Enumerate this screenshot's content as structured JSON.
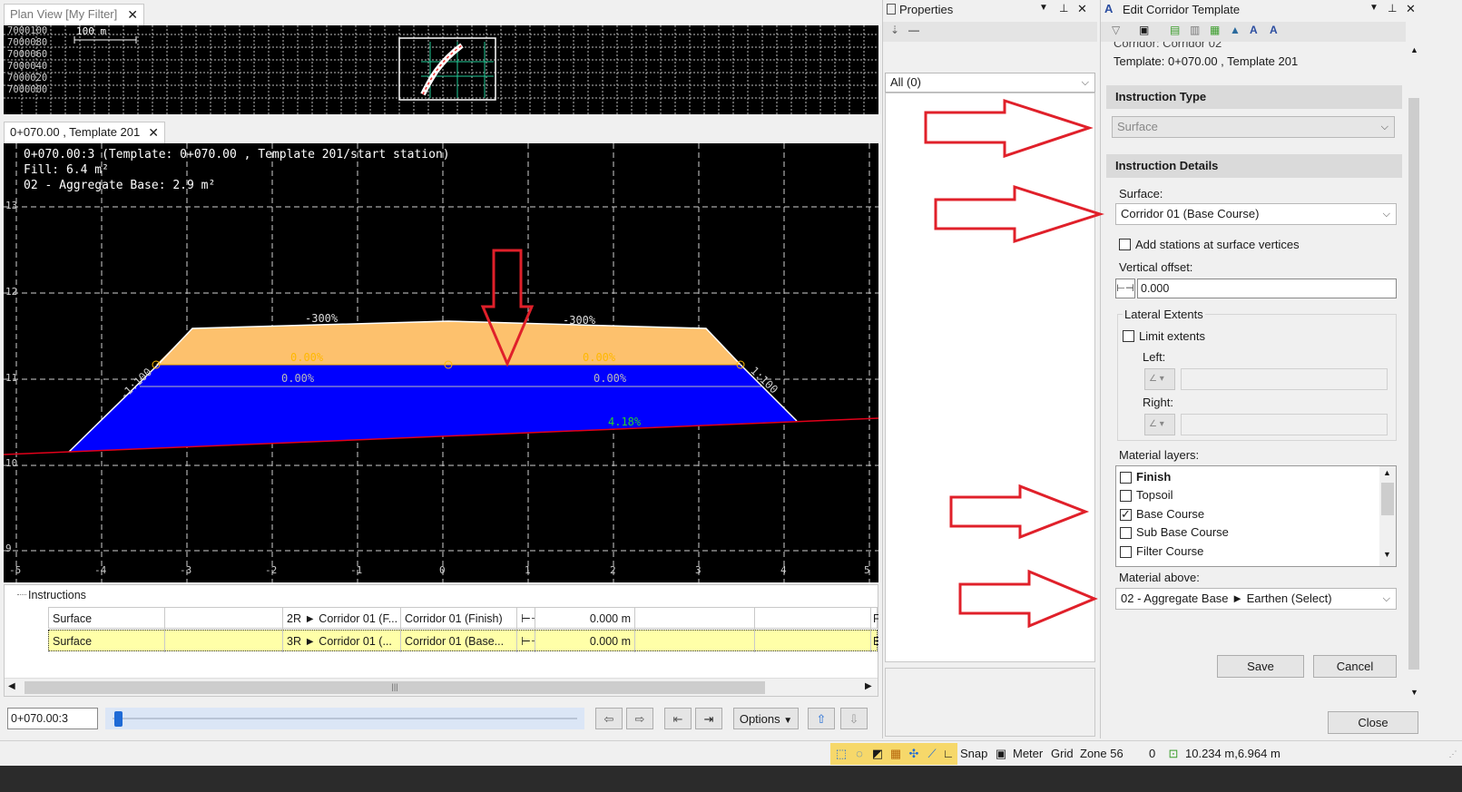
{
  "plan_view": {
    "tab_label": "Plan View [My Filter]",
    "scale_label": "100 m",
    "y_labels": [
      "7000100",
      "7000080",
      "7000060",
      "7000040",
      "7000020",
      "7000000"
    ]
  },
  "section_view": {
    "tab_label": "0+070.00 , Template 201",
    "info_line1": "0+070.00:3 (Template: 0+070.00 , Template 201/start station)",
    "info_line2": "Fill: 6.4 m²",
    "info_line3": "02 - Aggregate Base: 2.9 m²",
    "y_ticks": [
      "13",
      "12",
      "11",
      "10",
      "9"
    ],
    "x_ticks": [
      "-5",
      "-4",
      "-3",
      "-2",
      "-1",
      "0",
      "1",
      "2",
      "3",
      "4",
      "5"
    ],
    "slope_labels": {
      "top_left": "-300%",
      "top_right": "-300%",
      "yellow_left": "0.00%",
      "yellow_right": "0.00%",
      "blue_left": "0.00%",
      "blue_right": "0.00%",
      "side_left": "-1:100",
      "side_right": "1:100",
      "ground": "4.18%"
    },
    "colors": {
      "yellow": "#fdc16d",
      "blue": "#0000ff",
      "ground": "#e2001a"
    }
  },
  "instructions": {
    "header": "Instructions",
    "rows": [
      {
        "type": "Surface",
        "col2": "",
        "col3": "2R ► Corridor 01 (F...",
        "col4": "Corridor 01 (Finish)",
        "value": "0.000 m",
        "last": "F"
      },
      {
        "type": "Surface",
        "col2": "",
        "col3": "3R ► Corridor 01 (...",
        "col4": "Corridor 01 (Base...",
        "value": "0.000 m",
        "last": "E"
      }
    ]
  },
  "station_bar": {
    "station_value": "0+070.00:3",
    "options_label": "Options"
  },
  "properties": {
    "title": "Properties",
    "filter_value": "All (0)"
  },
  "edit_template": {
    "title": "Edit Corridor Template",
    "corridor_line": "Corridor: Corridor 02",
    "template_line": "Template: 0+070.00 , Template 201",
    "instruction_type_header": "Instruction Type",
    "instruction_type_value": "Surface",
    "instruction_details_header": "Instruction Details",
    "surface_label": "Surface:",
    "surface_value": "Corridor 01 (Base Course)",
    "add_stations_label": "Add stations at surface vertices",
    "vertical_offset_label": "Vertical offset:",
    "vertical_offset_value": "0.000",
    "lateral_extents_label": "Lateral Extents",
    "limit_extents_label": "Limit extents",
    "left_label": "Left:",
    "right_label": "Right:",
    "material_layers_label": "Material layers:",
    "material_layers": [
      {
        "name": "Finish",
        "checked": false,
        "bold": true
      },
      {
        "name": "Topsoil",
        "checked": false,
        "bold": false
      },
      {
        "name": "Base Course",
        "checked": true,
        "bold": false
      },
      {
        "name": "Sub Base Course",
        "checked": false,
        "bold": false
      },
      {
        "name": "Filter Course",
        "checked": false,
        "bold": false
      }
    ],
    "material_above_label": "Material above:",
    "material_above_value": "02 - Aggregate Base ► Earthen (Select)",
    "save_label": "Save",
    "cancel_label": "Cancel",
    "close_label": "Close"
  },
  "status_bar": {
    "snap": "Snap",
    "meter": "Meter",
    "grid": "Grid",
    "zone": "Zone 56",
    "count": "0",
    "coords": "10.234 m,6.964 m"
  },
  "annotation_arrow_color": "#e0202a"
}
